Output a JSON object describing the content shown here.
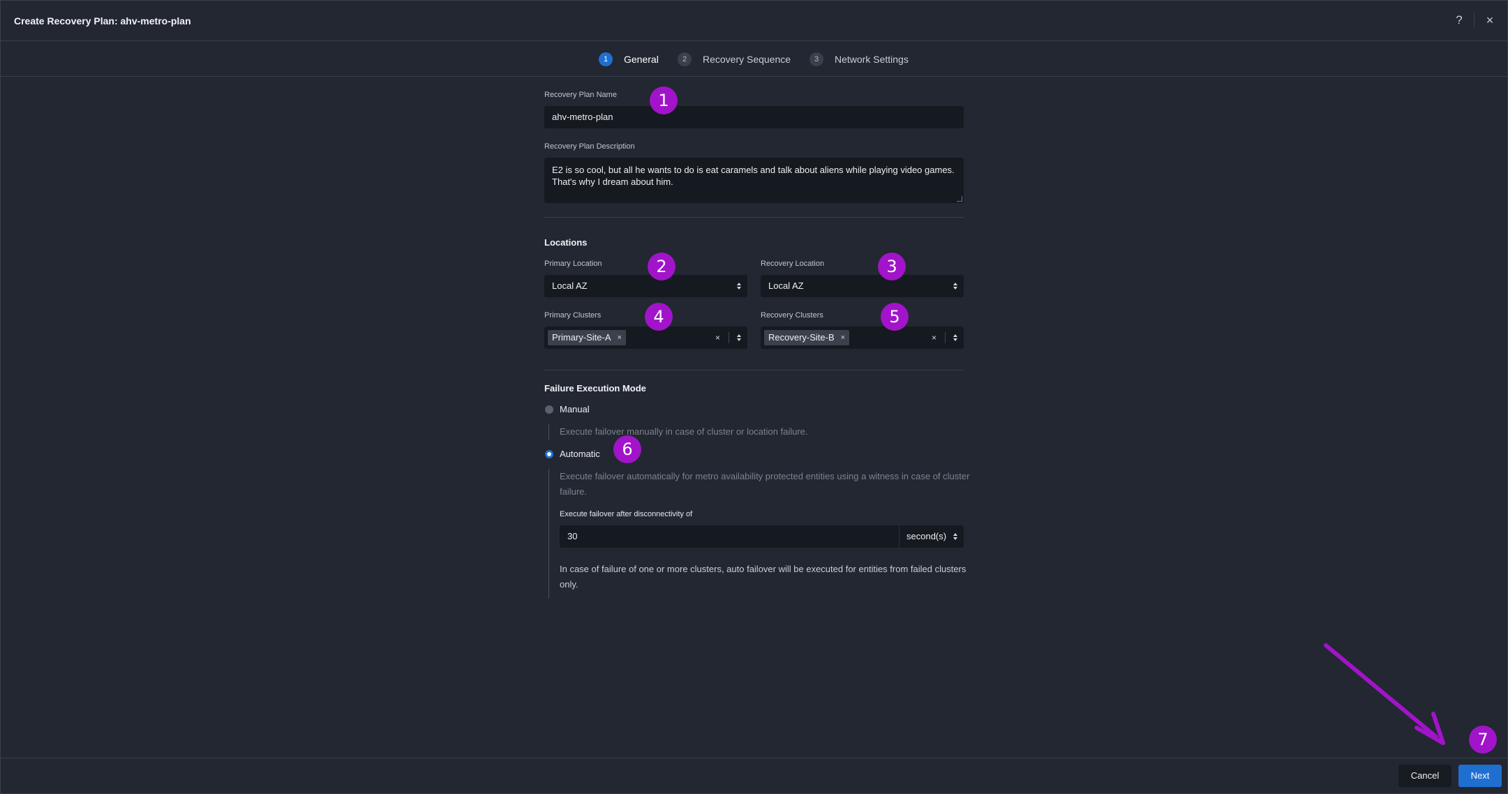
{
  "header": {
    "title": "Create Recovery Plan: ahv-metro-plan",
    "help_icon": "?",
    "close_icon": "×"
  },
  "steps": [
    {
      "num": "1",
      "label": "General",
      "active": true
    },
    {
      "num": "2",
      "label": "Recovery Sequence",
      "active": false
    },
    {
      "num": "3",
      "label": "Network Settings",
      "active": false
    }
  ],
  "form": {
    "name_label": "Recovery Plan Name",
    "name_value": "ahv-metro-plan",
    "desc_label": "Recovery Plan Description",
    "desc_value": "E2 is so cool, but all he wants to do is eat caramels and talk about aliens while playing video games. That's why I dream about him.",
    "locations_heading": "Locations",
    "primary_location_label": "Primary Location",
    "primary_location_value": "Local AZ",
    "recovery_location_label": "Recovery Location",
    "recovery_location_value": "Local AZ",
    "primary_clusters_label": "Primary Clusters",
    "primary_clusters_tag": "Primary-Site-A",
    "recovery_clusters_label": "Recovery Clusters",
    "recovery_clusters_tag": "Recovery-Site-B",
    "tag_remove": "×",
    "clear_x": "×",
    "failure_heading": "Failure Execution Mode",
    "manual_label": "Manual",
    "manual_help": "Execute failover manually in case of cluster or location failure.",
    "automatic_label": "Automatic",
    "automatic_help": "Execute failover automatically for metro availability protected entities using a witness in case of cluster failure.",
    "disconnect_label": "Execute failover after disconnectivity of",
    "disconnect_value": "30",
    "disconnect_unit": "second(s)",
    "auto_note": "In case of failure of one or more clusters, auto failover will be executed for entities from failed clusters only.",
    "selected_mode": "Automatic"
  },
  "footer": {
    "cancel_label": "Cancel",
    "next_label": "Next"
  },
  "annotations": [
    "1",
    "2",
    "3",
    "4",
    "5",
    "6",
    "7"
  ],
  "colors": {
    "background": "#222731",
    "input_bg": "#151920",
    "primary": "#1f6fd1",
    "annotation": "#a114c9"
  }
}
